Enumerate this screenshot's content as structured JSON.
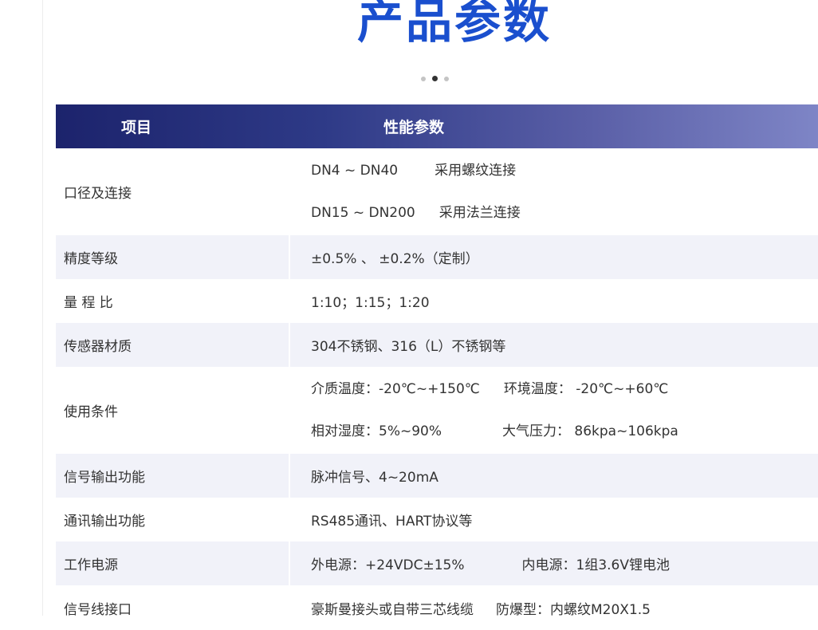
{
  "page": {
    "title": "产品参数"
  },
  "carousel": {
    "dots": 3,
    "active_index": 1
  },
  "table": {
    "headers": {
      "item": "项目",
      "params": "性能参数"
    },
    "rows": [
      {
        "label": "口径及连接",
        "lines": [
          {
            "a": "DN4 ~ DN40",
            "b": "采用螺纹连接"
          },
          {
            "a": "DN15 ~ DN200",
            "b": "采用法兰连接"
          }
        ]
      },
      {
        "label": "精度等级",
        "lines": [
          {
            "a": "±0.5% 、 ±0.2%（定制）"
          }
        ]
      },
      {
        "label": "量 程 比",
        "lines": [
          {
            "a": "1:10；1:15；1:20"
          }
        ]
      },
      {
        "label": "传感器材质",
        "lines": [
          {
            "a": "304不锈钢、316（L）不锈钢等"
          }
        ]
      },
      {
        "label": "使用条件",
        "lines": [
          {
            "a": "介质温度：-20℃~+150℃",
            "b": "环境温度： -20℃~+60℃"
          },
          {
            "a": "相对湿度：5%~90%",
            "b": "大气压力： 86kpa~106kpa"
          }
        ]
      },
      {
        "label": "信号输出功能",
        "lines": [
          {
            "a": "脉冲信号、4~20mA"
          }
        ]
      },
      {
        "label": "通讯输出功能",
        "lines": [
          {
            "a": "RS485通讯、HART协议等"
          }
        ]
      },
      {
        "label": "工作电源",
        "lines": [
          {
            "a": "外电源：+24VDC±15%",
            "b": "内电源：1组3.6V锂电池"
          }
        ]
      },
      {
        "label": "信号线接口",
        "lines": [
          {
            "a": "豪斯曼接头或自带三芯线缆",
            "b": "防爆型：内螺纹M20X1.5"
          }
        ]
      }
    ]
  }
}
